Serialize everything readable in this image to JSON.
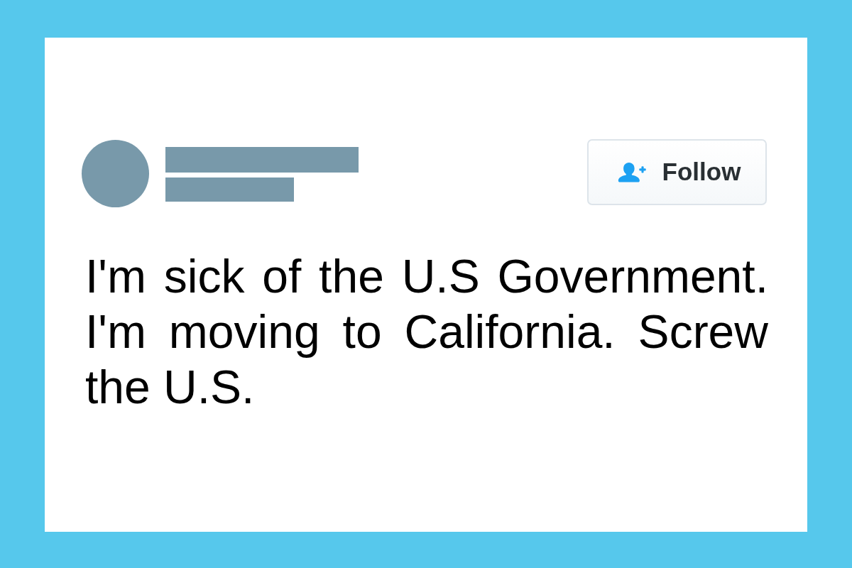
{
  "tweet": {
    "follow_button": {
      "label": "Follow"
    },
    "text": "I'm sick of the U.S Government. I'm moving to California. Screw the U.S."
  }
}
